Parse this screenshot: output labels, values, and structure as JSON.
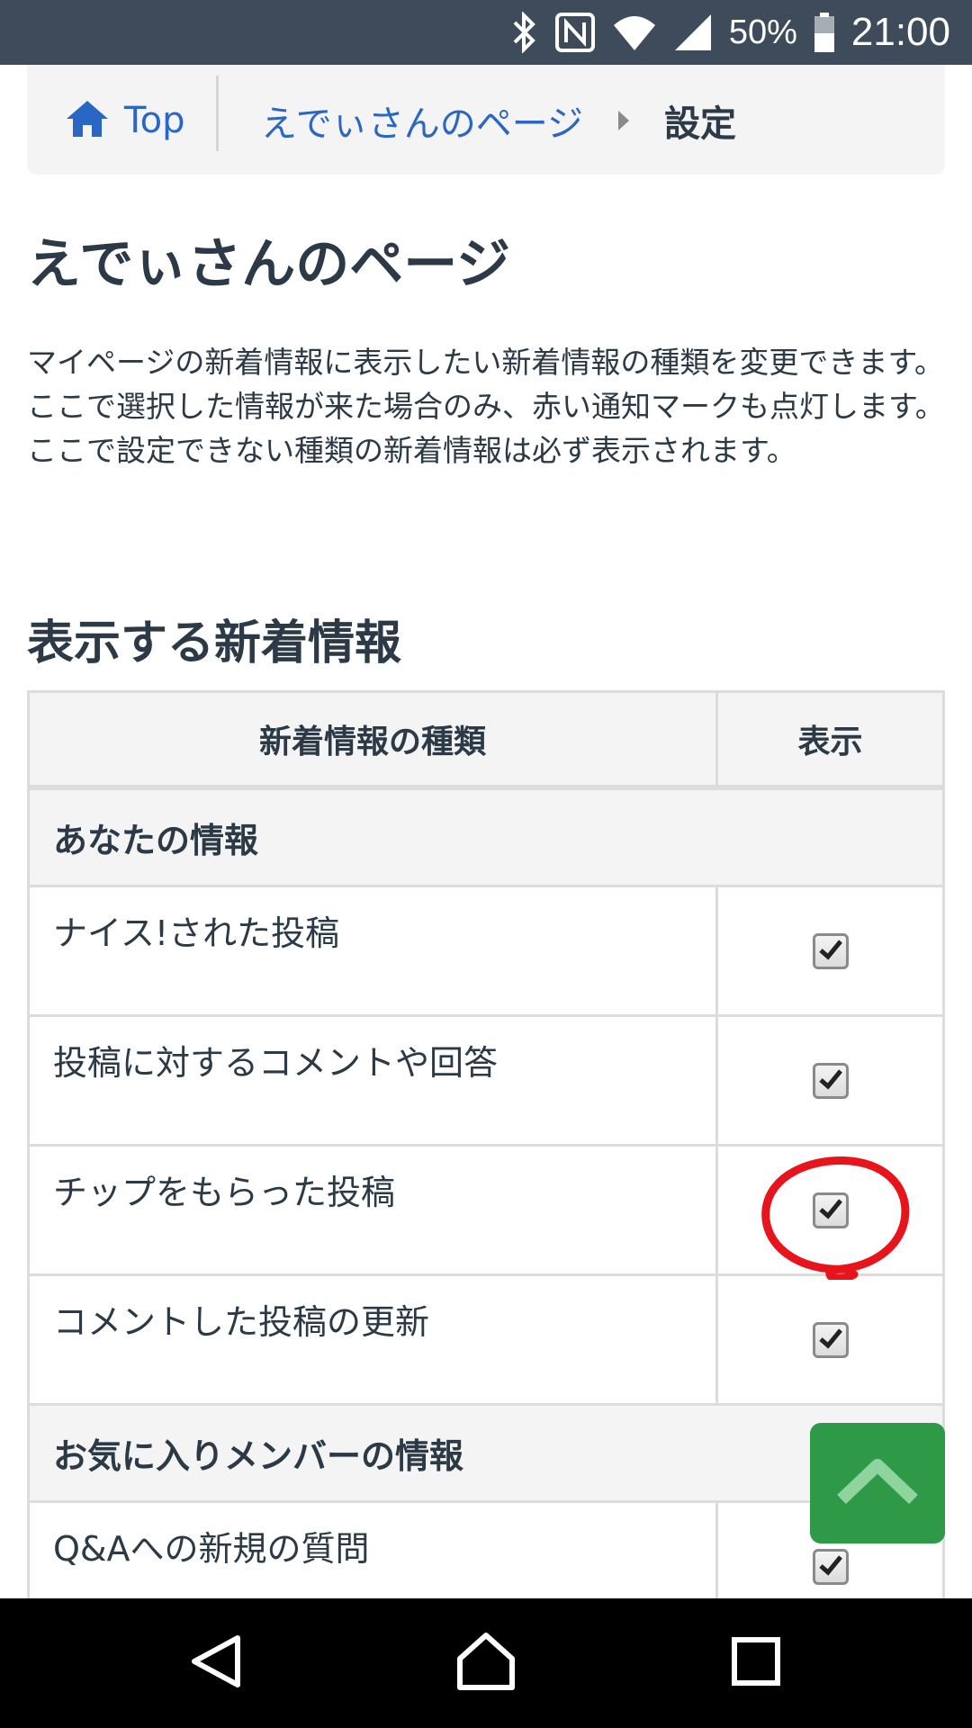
{
  "status_bar": {
    "icons": [
      "bluetooth-icon",
      "nfc-icon",
      "wifi-icon",
      "signal-icon",
      "battery-icon"
    ],
    "battery": "50%",
    "time": "21:00"
  },
  "breadcrumb": {
    "top_label": "Top",
    "page_label": "えでぃさんのページ",
    "current_label": "設定"
  },
  "page_title": "えでぃさんのページ",
  "description": [
    "マイページの新着情報に表示したい新着情報の種類を変更できます。",
    "ここで選択した情報が来た場合のみ、赤い通知マークも点灯します。",
    "ここで設定できない種類の新着情報は必ず表示されます。"
  ],
  "section_title": "表示する新着情報",
  "table": {
    "headers": [
      "新着情報の種類",
      "表示"
    ],
    "groups": [
      {
        "label": "あなたの情報",
        "items": [
          {
            "label": "ナイス!された投稿",
            "checked": true
          },
          {
            "label": "投稿に対するコメントや回答",
            "checked": true
          },
          {
            "label": "チップをもらった投稿",
            "checked": true
          },
          {
            "label": "コメントした投稿の更新",
            "checked": true
          }
        ]
      },
      {
        "label": "お気に入りメンバーの情報",
        "items": [
          {
            "label": "Q&Aへの新規の質問",
            "checked": true
          }
        ]
      }
    ]
  },
  "colors": {
    "status_bar": "#3d4b5a",
    "link": "#2a66c4",
    "scroll_button": "#2e9a47",
    "annotation": "#e8141c"
  }
}
